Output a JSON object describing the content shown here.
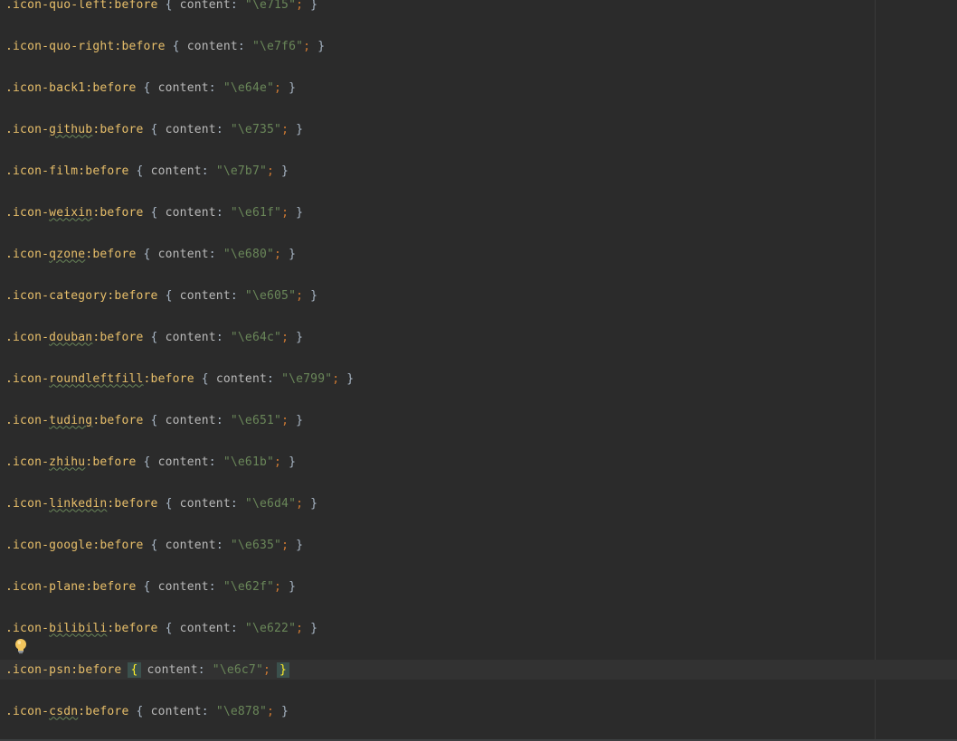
{
  "editor": {
    "lines": [
      {
        "prefix": ".icon-",
        "name": "quo-left",
        "typo": false,
        "pseudo": ":before",
        "open": " { ",
        "prop": "content",
        "colon": ": ",
        "value": "\"\\e715\"",
        "semi": ";",
        "close": " }",
        "current": false
      },
      {
        "prefix": ".icon-",
        "name": "quo-right",
        "typo": false,
        "pseudo": ":before",
        "open": " { ",
        "prop": "content",
        "colon": ": ",
        "value": "\"\\e7f6\"",
        "semi": ";",
        "close": " }",
        "current": false
      },
      {
        "prefix": ".icon-",
        "name": "back1",
        "typo": false,
        "pseudo": ":before",
        "open": " { ",
        "prop": "content",
        "colon": ": ",
        "value": "\"\\e64e\"",
        "semi": ";",
        "close": " }",
        "current": false
      },
      {
        "prefix": ".icon-",
        "name": "github",
        "typo": true,
        "pseudo": ":before",
        "open": " { ",
        "prop": "content",
        "colon": ": ",
        "value": "\"\\e735\"",
        "semi": ";",
        "close": " }",
        "current": false
      },
      {
        "prefix": ".icon-",
        "name": "film",
        "typo": false,
        "pseudo": ":before",
        "open": " { ",
        "prop": "content",
        "colon": ": ",
        "value": "\"\\e7b7\"",
        "semi": ";",
        "close": " }",
        "current": false
      },
      {
        "prefix": ".icon-",
        "name": "weixin",
        "typo": true,
        "pseudo": ":before",
        "open": " { ",
        "prop": "content",
        "colon": ": ",
        "value": "\"\\e61f\"",
        "semi": ";",
        "close": " }",
        "current": false
      },
      {
        "prefix": ".icon-",
        "name": "qzone",
        "typo": true,
        "pseudo": ":before",
        "open": " { ",
        "prop": "content",
        "colon": ": ",
        "value": "\"\\e680\"",
        "semi": ";",
        "close": " }",
        "current": false
      },
      {
        "prefix": ".icon-",
        "name": "category",
        "typo": false,
        "pseudo": ":before",
        "open": " { ",
        "prop": "content",
        "colon": ": ",
        "value": "\"\\e605\"",
        "semi": ";",
        "close": " }",
        "current": false
      },
      {
        "prefix": ".icon-",
        "name": "douban",
        "typo": true,
        "pseudo": ":before",
        "open": " { ",
        "prop": "content",
        "colon": ": ",
        "value": "\"\\e64c\"",
        "semi": ";",
        "close": " }",
        "current": false
      },
      {
        "prefix": ".icon-",
        "name": "roundleftfill",
        "typo": true,
        "pseudo": ":before",
        "open": " { ",
        "prop": "content",
        "colon": ": ",
        "value": "\"\\e799\"",
        "semi": ";",
        "close": " }",
        "current": false
      },
      {
        "prefix": ".icon-",
        "name": "tuding",
        "typo": true,
        "pseudo": ":before",
        "open": " { ",
        "prop": "content",
        "colon": ": ",
        "value": "\"\\e651\"",
        "semi": ";",
        "close": " }",
        "current": false
      },
      {
        "prefix": ".icon-",
        "name": "zhihu",
        "typo": true,
        "pseudo": ":before",
        "open": " { ",
        "prop": "content",
        "colon": ": ",
        "value": "\"\\e61b\"",
        "semi": ";",
        "close": " }",
        "current": false
      },
      {
        "prefix": ".icon-",
        "name": "linkedin",
        "typo": true,
        "pseudo": ":before",
        "open": " { ",
        "prop": "content",
        "colon": ": ",
        "value": "\"\\e6d4\"",
        "semi": ";",
        "close": " }",
        "current": false
      },
      {
        "prefix": ".icon-",
        "name": "google",
        "typo": false,
        "pseudo": ":before",
        "open": " { ",
        "prop": "content",
        "colon": ": ",
        "value": "\"\\e635\"",
        "semi": ";",
        "close": " }",
        "current": false
      },
      {
        "prefix": ".icon-",
        "name": "plane",
        "typo": false,
        "pseudo": ":before",
        "open": " { ",
        "prop": "content",
        "colon": ": ",
        "value": "\"\\e62f\"",
        "semi": ";",
        "close": " }",
        "current": false
      },
      {
        "prefix": ".icon-",
        "name": "bilibili",
        "typo": true,
        "pseudo": ":before",
        "open": " { ",
        "prop": "content",
        "colon": ": ",
        "value": "\"\\e622\"",
        "semi": ";",
        "close": " }",
        "current": false
      },
      {
        "prefix": ".icon-",
        "name": "psn",
        "typo": false,
        "pseudo": ":before",
        "open": " { ",
        "prop": "content",
        "colon": ": ",
        "value": "\"\\e6c7\"",
        "semi": ";",
        "close": " }",
        "current": true
      },
      {
        "prefix": ".icon-",
        "name": "csdn",
        "typo": true,
        "pseudo": ":before",
        "open": " { ",
        "prop": "content",
        "colon": ": ",
        "value": "\"\\e878\"",
        "semi": ";",
        "close": " }",
        "current": false
      }
    ]
  },
  "gutter": {
    "intention_icon": "lightbulb-icon"
  },
  "colors": {
    "background": "#2b2b2b",
    "selector": "#e8bf6a",
    "punctuation": "#cc7832",
    "property": "#bababa",
    "string": "#6a8759",
    "caret_row": "#323232",
    "brace_match": "#3b514d"
  }
}
